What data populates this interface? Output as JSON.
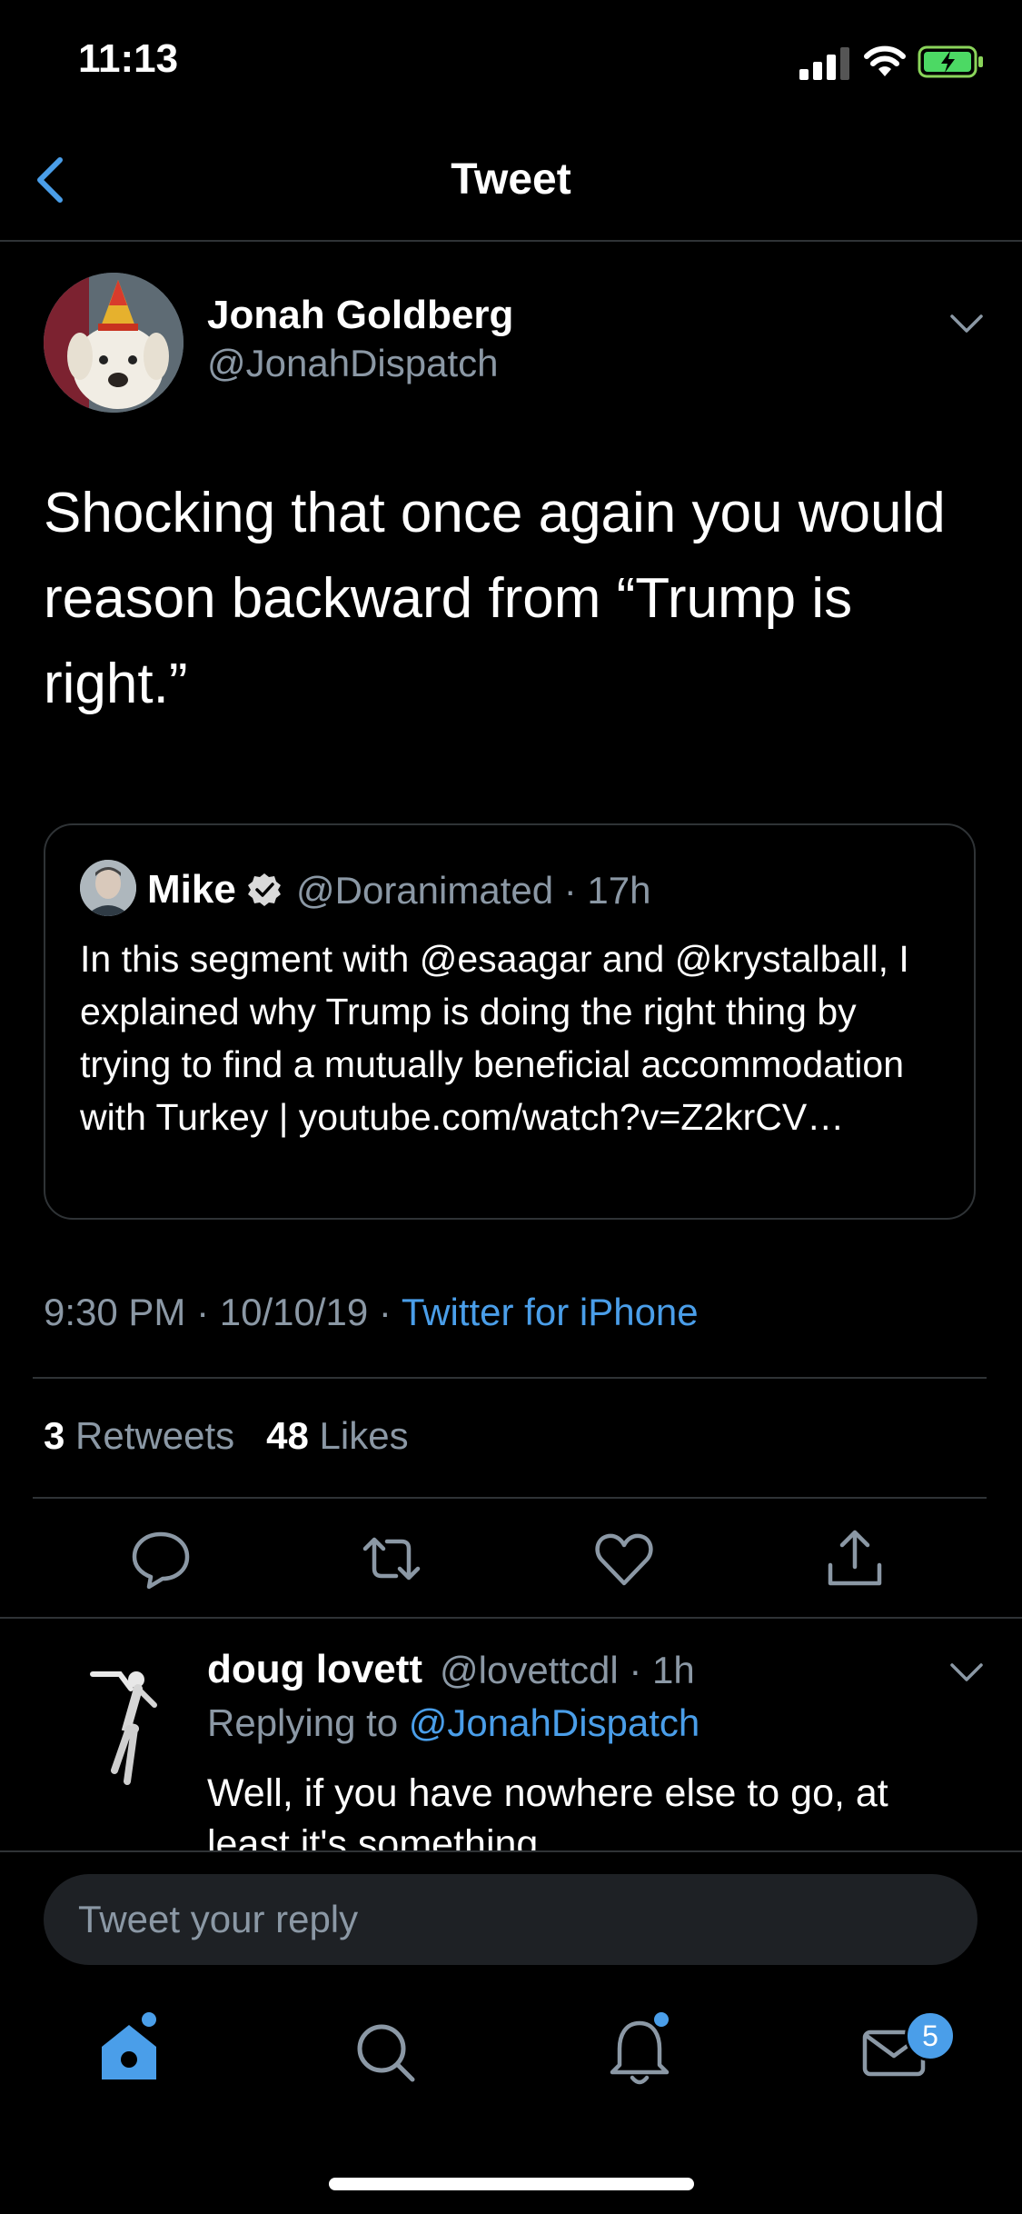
{
  "status": {
    "time": "11:13"
  },
  "nav": {
    "title": "Tweet"
  },
  "tweet": {
    "author_name": "Jonah Goldberg",
    "author_handle": "@JonahDispatch",
    "text": "Shocking that once again you would reason backward from “Trump is right.”",
    "time": "9:30 PM",
    "date": "10/10/19",
    "source": "Twitter for iPhone",
    "retweets_count": "3",
    "retweets_label": "Retweets",
    "likes_count": "48",
    "likes_label": "Likes"
  },
  "quote": {
    "name": "Mike",
    "handle": "@Doranimated",
    "time": "17h",
    "text": "In this segment with @esaagar and @krystalball, I explained why Trump is doing the right thing by trying to find a mutually beneficial accommodation with Turkey | youtube.com/watch?v=Z2krCV…"
  },
  "reply": {
    "name": "doug lovett",
    "handle": "@lovettcdl",
    "time": "1h",
    "replying_prefix": "Replying to",
    "replying_to": "@JonahDispatch",
    "text": "Well, if you have nowhere else to go, at least it's something."
  },
  "composer": {
    "placeholder": "Tweet your reply"
  },
  "tabbar": {
    "messages_badge": "5"
  },
  "colors": {
    "accent": "#4a9ee9",
    "background": "#000000",
    "muted": "#8b98a5",
    "divider": "#2f3336"
  },
  "icons": [
    "back-chevron-icon",
    "chevron-down-icon",
    "verified-icon",
    "reply-icon",
    "retweet-icon",
    "like-icon",
    "share-icon",
    "home-icon",
    "search-icon",
    "notifications-icon",
    "messages-icon"
  ]
}
